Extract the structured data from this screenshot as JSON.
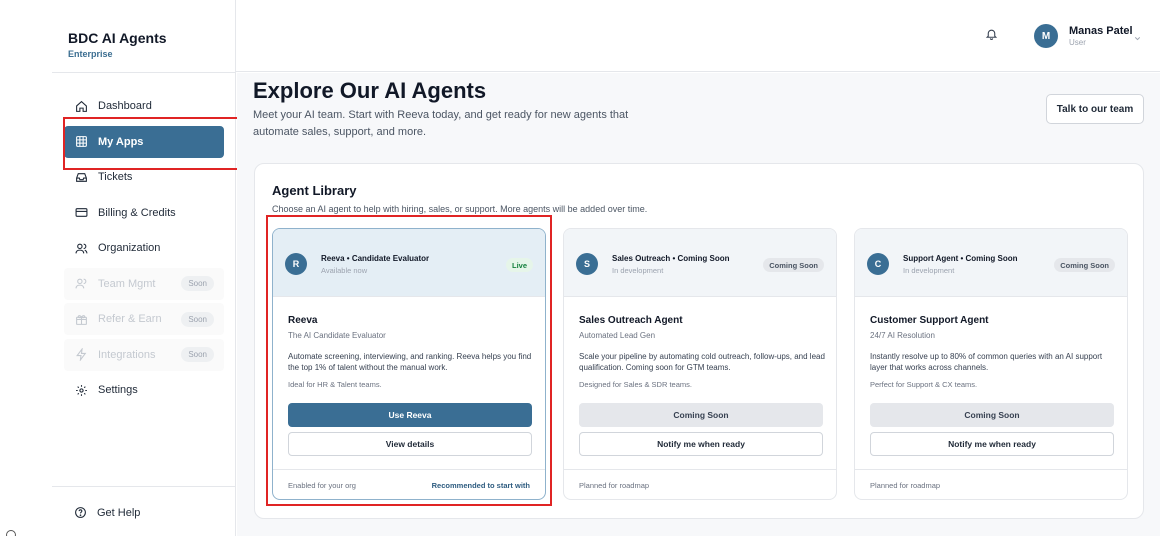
{
  "brand": {
    "title": "BDC AI Agents",
    "subtitle": "Enterprise"
  },
  "sidebar": {
    "items": [
      {
        "label": "Dashboard",
        "icon": "home-icon"
      },
      {
        "label": "My Apps",
        "icon": "grid-icon",
        "active": true
      },
      {
        "label": "Tickets",
        "icon": "inbox-icon"
      },
      {
        "label": "Billing & Credits",
        "icon": "credit-card-icon"
      },
      {
        "label": "Organization",
        "icon": "users-icon"
      },
      {
        "label": "Team Mgmt",
        "icon": "team-icon",
        "badge": "Soon"
      },
      {
        "label": "Refer & Earn",
        "icon": "gift-icon",
        "badge": "Soon"
      },
      {
        "label": "Integrations",
        "icon": "plug-icon",
        "badge": "Soon"
      },
      {
        "label": "Settings",
        "icon": "gear-icon"
      }
    ],
    "help_label": "Get Help"
  },
  "header": {
    "user_name": "Manas Patel",
    "user_role": "User",
    "avatar_initial": "M"
  },
  "main": {
    "title": "Explore Our AI Agents",
    "subtitle": "Meet your AI team. Start with Reeva today, and get ready for new agents that automate sales, support, and more.",
    "talk_button": "Talk to our team",
    "library_title": "Agent Library",
    "library_subtitle": "Choose an AI agent to help with hiring, sales, or support. More agents will be added over time.",
    "cards": [
      {
        "initial": "R",
        "head_title": "Reeva • Candidate Evaluator",
        "head_sub": "Available now",
        "badge": "Live",
        "name": "Reeva",
        "tag": "The AI Candidate Evaluator",
        "desc": "Automate screening, interviewing, and ranking. Reeva helps you find the top 1% of talent without the manual work.",
        "note": "Ideal for HR & Talent teams.",
        "primary": "Use Reeva",
        "secondary": "View details",
        "foot_left": "Enabled for your org",
        "foot_right": "Recommended to start with"
      },
      {
        "initial": "S",
        "head_title": "Sales Outreach • Coming Soon",
        "head_sub": "In development",
        "badge": "Coming Soon",
        "name": "Sales Outreach Agent",
        "tag": "Automated Lead Gen",
        "desc": "Scale your pipeline by automating cold outreach, follow-ups, and lead qualification. Coming soon for GTM teams.",
        "note": "Designed for Sales & SDR teams.",
        "primary": "Coming Soon",
        "secondary": "Notify me when ready",
        "foot_left": "Planned for roadmap"
      },
      {
        "initial": "C",
        "head_title": "Support Agent • Coming Soon",
        "head_sub": "In development",
        "badge": "Coming Soon",
        "name": "Customer Support Agent",
        "tag": "24/7 AI Resolution",
        "desc": "Instantly resolve up to 80% of common queries with an AI support layer that works across channels.",
        "note": "Perfect for Support & CX teams.",
        "primary": "Coming Soon",
        "secondary": "Notify me when ready",
        "foot_left": "Planned for roadmap"
      }
    ]
  },
  "colors": {
    "accent": "#3a6e94",
    "highlight": "#e02424",
    "live": "#15803d"
  }
}
